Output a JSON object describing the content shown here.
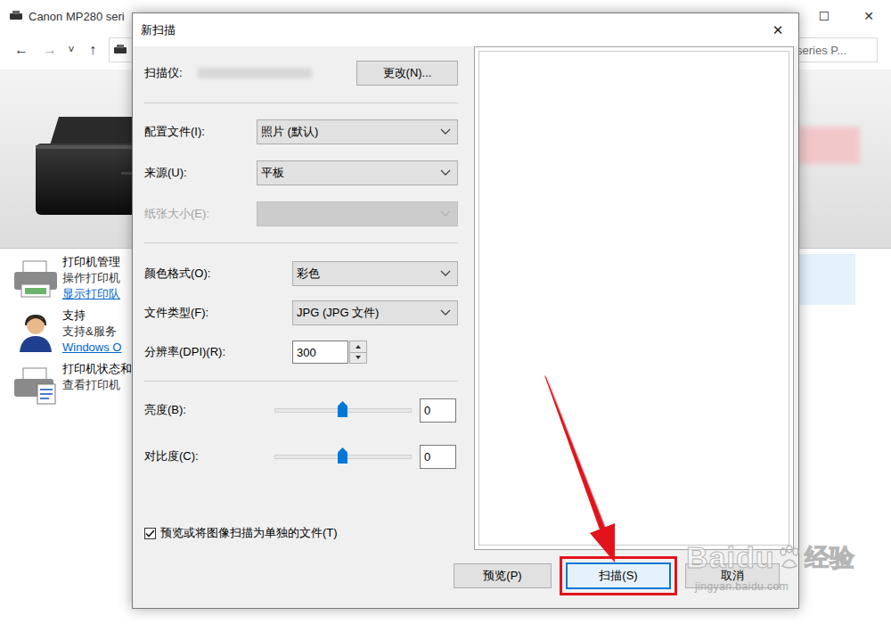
{
  "background_window": {
    "title": "Canon MP280 seri",
    "title_buttons": [
      "☐",
      "✕"
    ],
    "toolbar": {
      "back": "←",
      "forward": "→",
      "dropdown": "˅",
      "up": "↑",
      "search": "series P..."
    },
    "tasks": [
      {
        "title": "打印机管理",
        "line": "操作打印机",
        "link": "显示打印队"
      },
      {
        "title": "支持",
        "line": "支持&服务",
        "link": "Windows O"
      },
      {
        "title": "打印机状态和",
        "line": "查看打印机",
        "link": ""
      }
    ]
  },
  "dialog": {
    "title": "新扫描",
    "close": "✕",
    "scanner": {
      "label": "扫描仪:",
      "button": "更改(N)..."
    },
    "sections": [
      {
        "rows": [
          {
            "kind": "select",
            "label": "配置文件(I):",
            "value": "照片 (默认)",
            "disabled": false
          },
          {
            "kind": "select",
            "label": "来源(U):",
            "value": "平板",
            "disabled": false
          },
          {
            "kind": "select",
            "label": "纸张大小(E):",
            "value": "",
            "disabled": true
          }
        ]
      },
      {
        "rows": [
          {
            "kind": "select",
            "label": "颜色格式(O):",
            "value": "彩色",
            "disabled": false
          },
          {
            "kind": "select",
            "label": "文件类型(F):",
            "value": "JPG (JPG 文件)",
            "disabled": false
          },
          {
            "kind": "spinner",
            "label": "分辨率(DPI)(R):",
            "value": "300",
            "disabled": false
          }
        ]
      },
      {
        "rows": [
          {
            "kind": "slider",
            "label": "亮度(B):",
            "value": "0",
            "level": 0.5,
            "disabled": false
          },
          {
            "kind": "slider",
            "label": "对比度(C):",
            "value": "0",
            "level": 0.5,
            "disabled": false
          }
        ]
      }
    ],
    "checkbox": {
      "label": "预览或将图像扫描为单独的文件(T)",
      "checked": true
    },
    "buttons": [
      {
        "label": "预览(P)",
        "highlighted": false
      },
      {
        "label": "扫描(S)",
        "highlighted": true
      },
      {
        "label": "取消",
        "highlighted": false
      }
    ]
  },
  "watermark": {
    "brand": "Baidu",
    "suffix": "经验",
    "url": "jingyan.baidu.com"
  }
}
